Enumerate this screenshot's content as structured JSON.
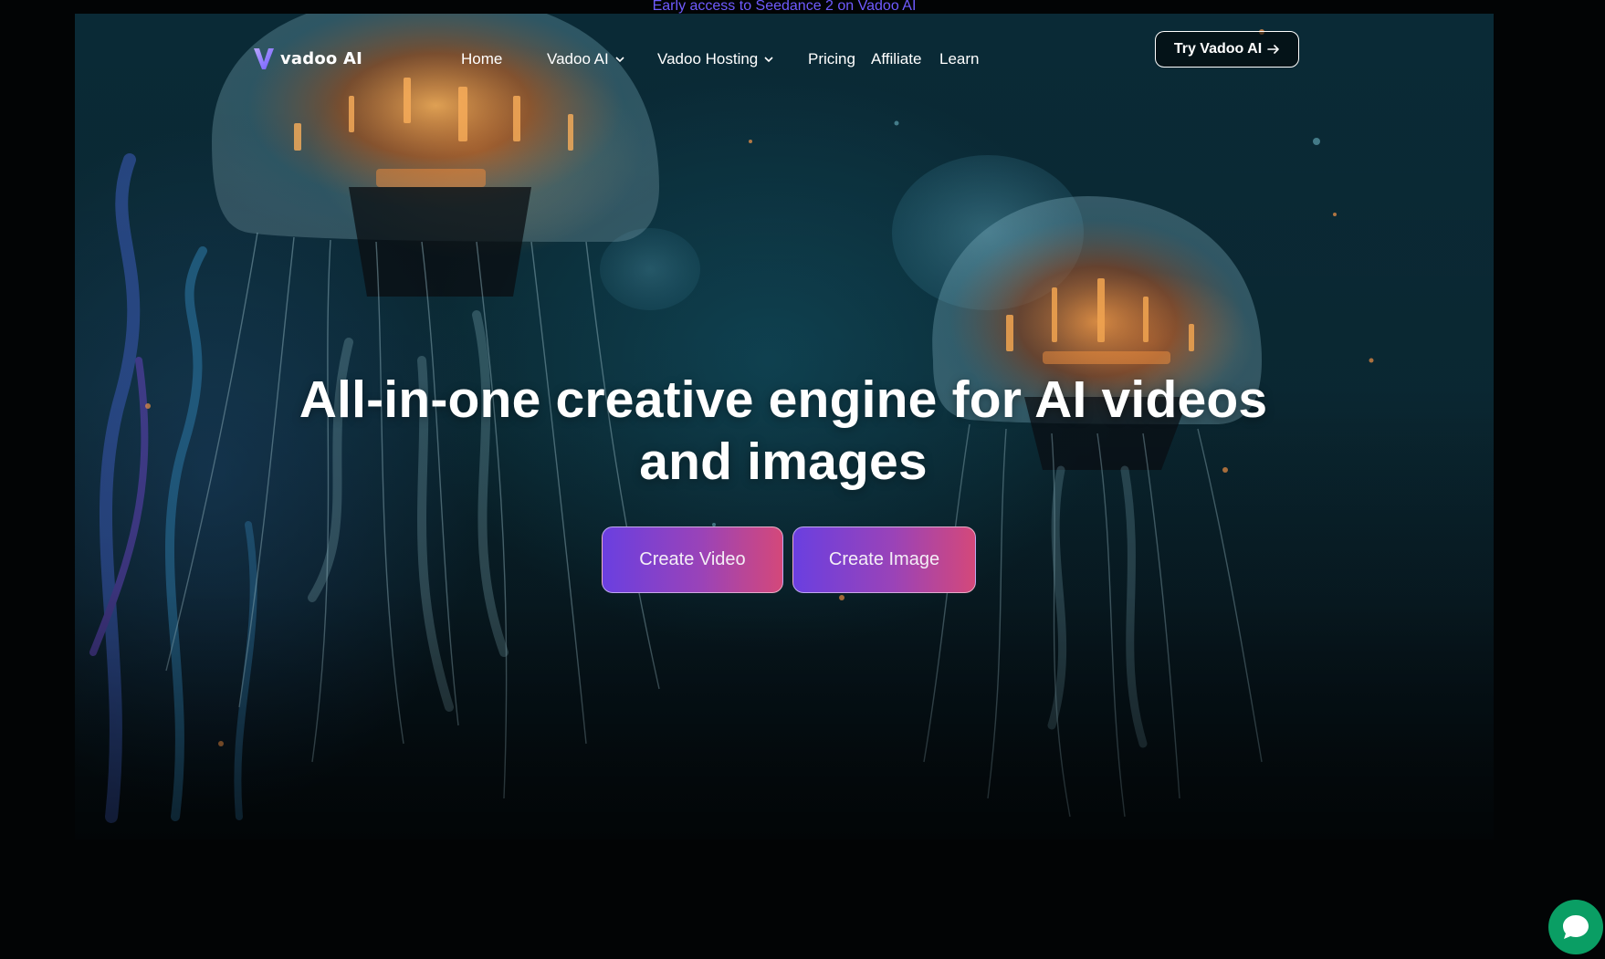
{
  "announcement": {
    "text": "Early access to Seedance 2 on Vadoo AI"
  },
  "brand": {
    "name": "vadoo AI",
    "logo_icon": "v-logo-icon",
    "accent": "#6f5bff"
  },
  "nav": {
    "items": [
      {
        "label": "Home",
        "has_dropdown": false
      },
      {
        "label": "Vadoo AI",
        "has_dropdown": true
      },
      {
        "label": "Vadoo Hosting",
        "has_dropdown": true
      },
      {
        "label": "Pricing",
        "has_dropdown": false
      },
      {
        "label": "Affiliate",
        "has_dropdown": false
      },
      {
        "label": "Learn",
        "has_dropdown": false
      }
    ],
    "cta_label": "Try Vadoo AI",
    "cta_icon": "arrow-right-icon"
  },
  "hero": {
    "headline": "All-in-one creative engine for AI videos and images",
    "create_video_label": "Create Video",
    "create_image_label": "Create Image",
    "button_gradient": [
      "#6a3fe0",
      "#d4487a"
    ]
  },
  "chat": {
    "icon": "chat-bubble-icon",
    "color": "#0a9e64"
  }
}
